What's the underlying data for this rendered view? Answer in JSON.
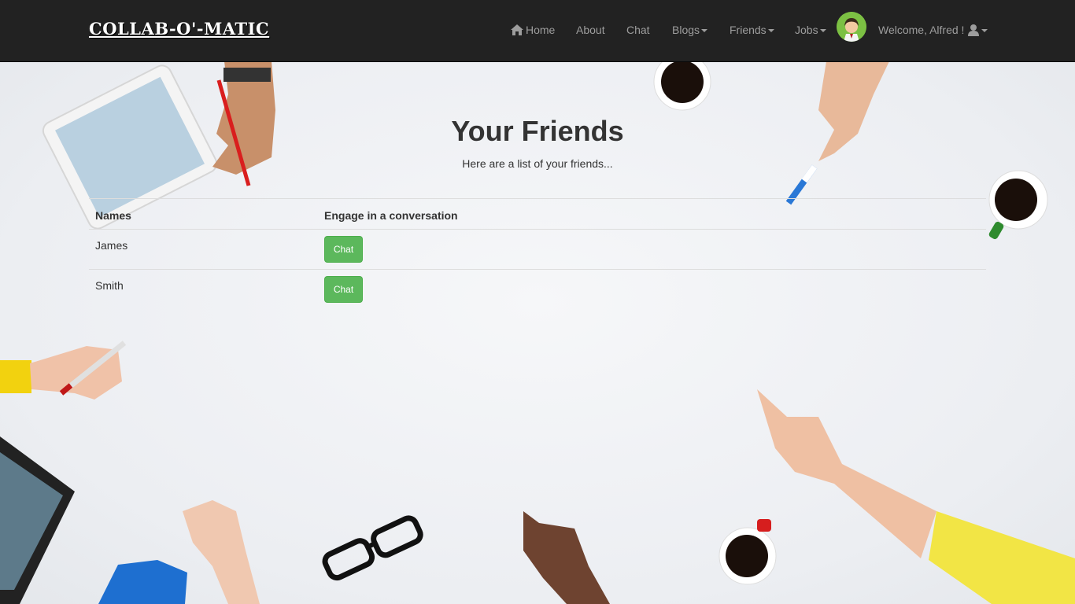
{
  "brand": {
    "name": "COLLAB-O'-MATIC"
  },
  "nav": {
    "home": "Home",
    "about": "About",
    "chat": "Chat",
    "blogs": "Blogs",
    "friends": "Friends",
    "jobs": "Jobs",
    "welcome": "Welcome, Alfred !"
  },
  "page": {
    "title": "Your Friends",
    "subtitle": "Here are a list of your friends..."
  },
  "table": {
    "headers": [
      "Names",
      "Engage in a conversation"
    ],
    "rows": [
      {
        "name": "James",
        "action": "Chat"
      },
      {
        "name": "Smith",
        "action": "Chat"
      }
    ]
  },
  "colors": {
    "navbar": "#222222",
    "nav_text": "#9d9d9d",
    "button": "#5cb85c",
    "avatar_bg": "#7cc043"
  },
  "icons": [
    "home-icon",
    "caret-down-icon",
    "avatar",
    "user-icon"
  ]
}
